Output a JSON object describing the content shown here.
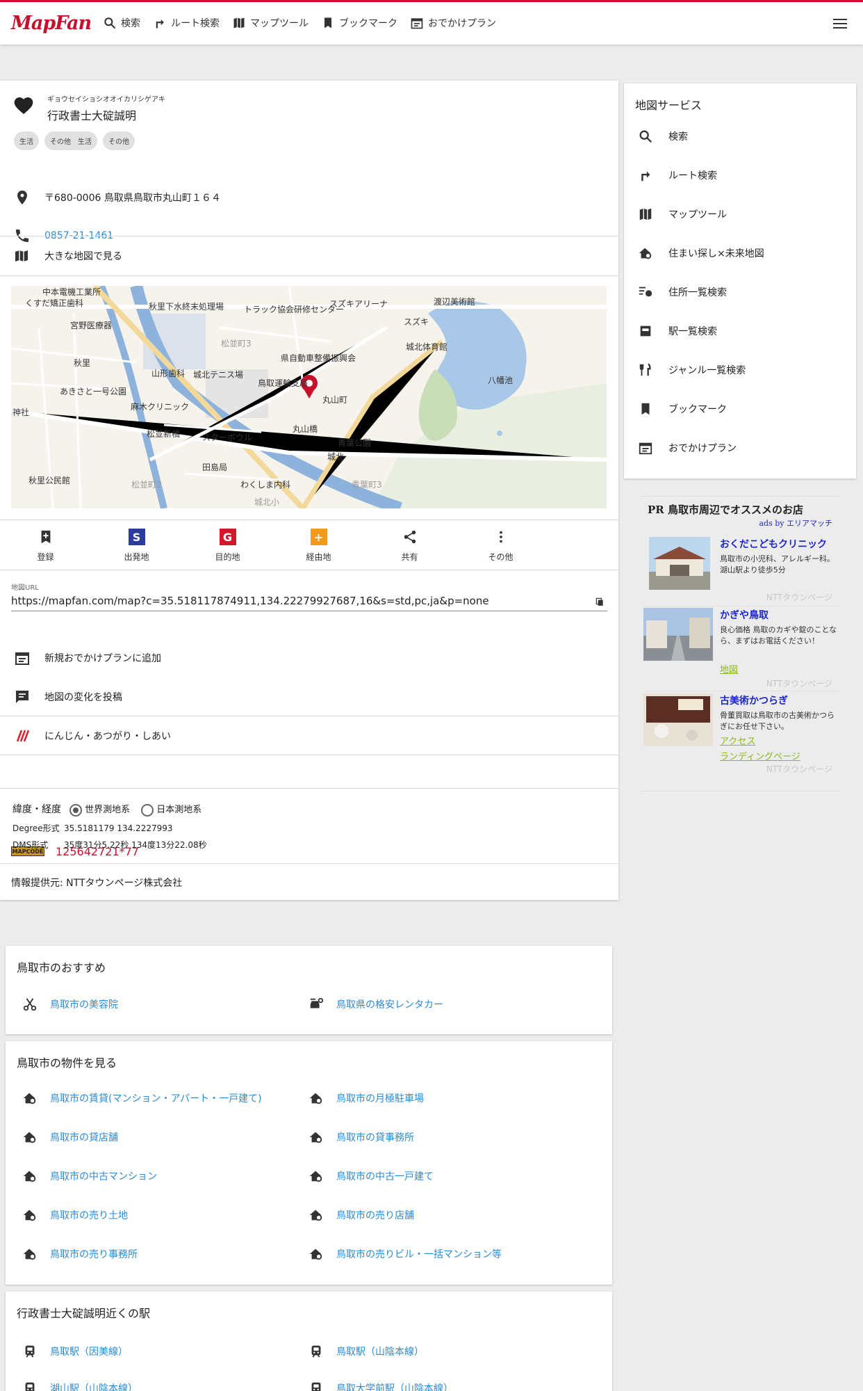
{
  "header": {
    "logo": "MapFan",
    "nav": [
      "検索",
      "ルート検索",
      "マップツール",
      "ブックマーク",
      "おでかけプラン"
    ]
  },
  "place": {
    "kana": "ギョウセイショシオオイカリシゲアキ",
    "name": "行政書士大碇誠明",
    "tags": [
      "生活",
      "その他　生活",
      "その他"
    ],
    "address": "〒680-0006 鳥取県鳥取市丸山町１６４",
    "phone": "0857-21-1461",
    "big_map": "大きな地図で見る"
  },
  "map_labels": [
    "中本電機工業所",
    "くすだ矯正歯科",
    "宮野医療器",
    "秋里下水終末処理場",
    "トラック協会研修センター",
    "スズキアリーナ",
    "渡辺美術館",
    "スズキ",
    "城北体育館",
    "松並町3",
    "県自動車整備振興会",
    "秋里",
    "山形歯科",
    "城北テニス場",
    "鳥取運輸支局",
    "八幡池",
    "あきさと一号公園",
    "麻木クリニック",
    "丸山町",
    "丸山橋",
    "神社",
    "松並新橋",
    "スターボウル",
    "青葉公園",
    "城北",
    "田島局",
    "秋里公民館",
    "松並町2",
    "わくしま内科",
    "青葉町3",
    "城北小"
  ],
  "actions": [
    "登録",
    "出発地",
    "目的地",
    "経由地",
    "共有",
    "その他"
  ],
  "url": {
    "label": "地図URL",
    "value": "https://mapfan.com/map?c=35.518117874911,134.22279927687,16&s=std,pc,ja&p=none"
  },
  "menu_rows": [
    "新規おでかけプランに追加",
    "地図の変化を投稿",
    "にんじん・あつがり・しあい"
  ],
  "mapcode": {
    "badge": "MAPCODE",
    "value": "125642721*77"
  },
  "coords": {
    "label": "緯度・経度",
    "world": "世界測地系",
    "japan": "日本測地系",
    "degree_label": "Degree形式",
    "degree": "35.5181179 134.2227993",
    "dms_label": "DMS形式",
    "dms": "35度31分5.22秒 134度13分22.08秒"
  },
  "source": "情報提供元: NTTタウンページ株式会社",
  "sidebar": {
    "title": "地図サービス",
    "items": [
      "検索",
      "ルート検索",
      "マップツール",
      "住まい探し×未来地図",
      "住所一覧検索",
      "駅一覧検索",
      "ジャンル一覧検索",
      "ブックマーク",
      "おでかけプラン"
    ]
  },
  "pr": {
    "title": "PR 鳥取市周辺でオススメのお店",
    "by": "ads by エリアマッチ",
    "ads": [
      {
        "name": "おくだこどもクリニック",
        "desc": "鳥取市の小児科、アレルギー科。湖山駅より徒歩5分",
        "links": [],
        "src": "NTTタウンページ"
      },
      {
        "name": "かぎや鳥取",
        "desc": "良心価格 鳥取のカギや錠のことなら、まずはお電話ください！",
        "links": [
          "地図"
        ],
        "src": "NTTタウンページ"
      },
      {
        "name": "古美術かつらぎ",
        "desc": "骨董買取は鳥取市の古美術かつらぎにお任せ下さい。",
        "links": [
          "アクセス",
          "ランディングページ"
        ],
        "src": "NTTタウンページ"
      }
    ]
  },
  "recommend": {
    "title": "鳥取市のおすすめ",
    "links": [
      "鳥取市の美容院",
      "鳥取県の格安レンタカー"
    ]
  },
  "property": {
    "title": "鳥取市の物件を見る",
    "links": [
      "鳥取市の賃貸(マンション・アパート・一戸建て)",
      "鳥取市の月極駐車場",
      "鳥取市の貸店舗",
      "鳥取市の貸事務所",
      "鳥取市の中古マンション",
      "鳥取市の中古一戸建て",
      "鳥取市の売り土地",
      "鳥取市の売り店舗",
      "鳥取市の売り事務所",
      "鳥取市の売りビル・一括マンション等"
    ]
  },
  "stations": {
    "title": "行政書士大碇誠明近くの駅",
    "links": [
      "鳥取駅（因美線）",
      "鳥取駅（山陰本線）",
      "湖山駅（山陰本線）",
      "鳥取大学前駅（山陰本線）"
    ]
  }
}
